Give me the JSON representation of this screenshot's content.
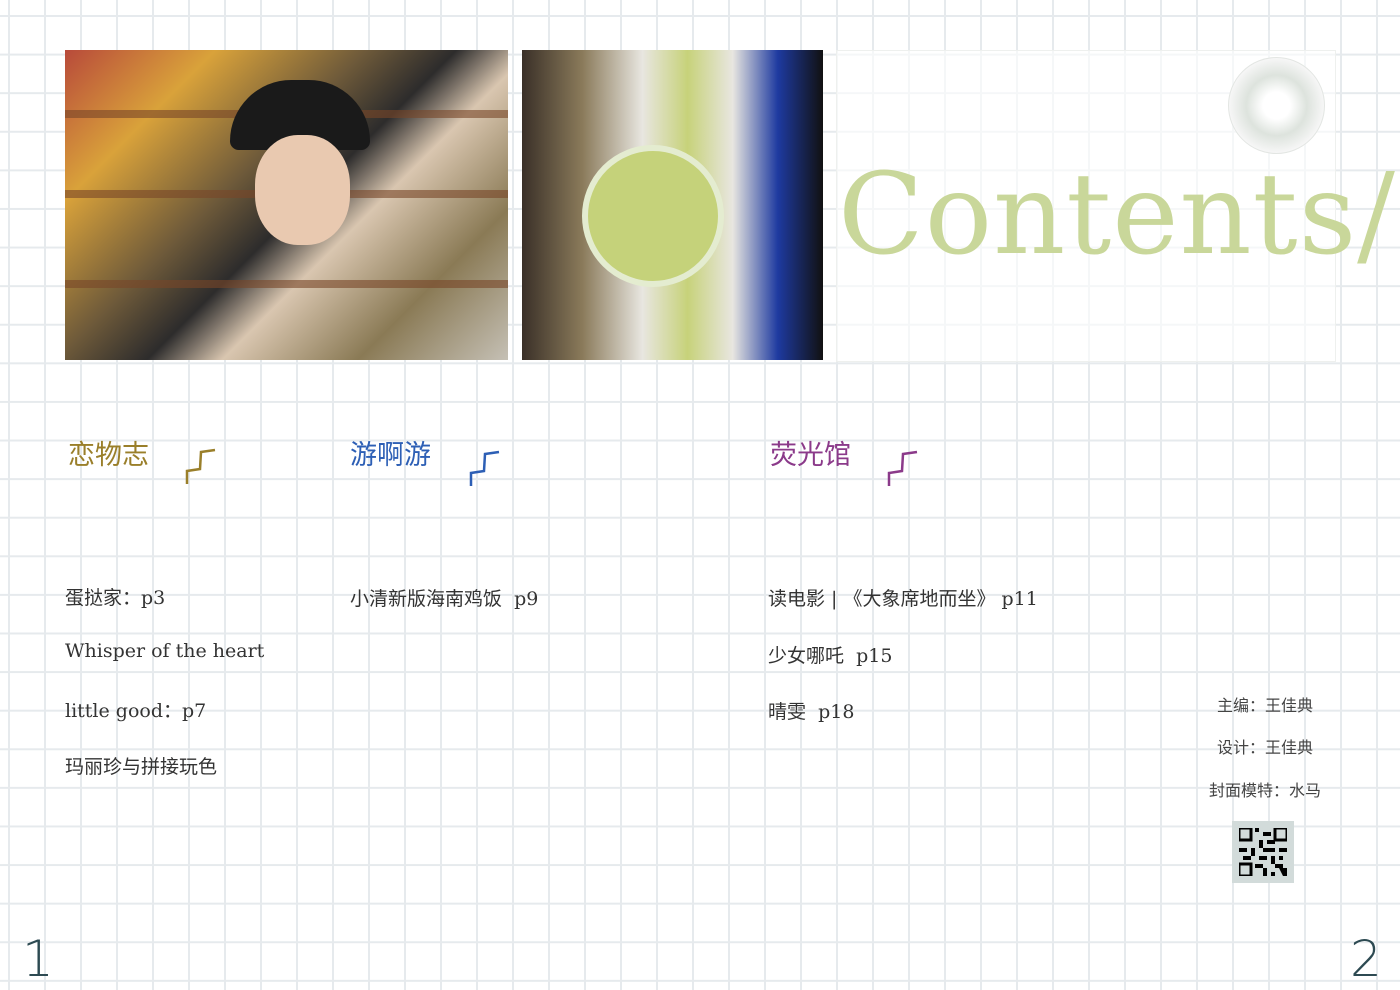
{
  "title": "Contents/",
  "colors": {
    "title": "#c9d79a",
    "section1": "#9a7f2a",
    "section2": "#2d5fb5",
    "section3": "#8b3a8a"
  },
  "sections": [
    {
      "heading": "恋物志",
      "items": [
        "蛋挞家：p3",
        "Whisper of the heart",
        "little good：p7",
        "玛丽珍与拼接玩色"
      ]
    },
    {
      "heading": "游啊游",
      "items": [
        "小清新版海南鸡饭  p9"
      ]
    },
    {
      "heading": "荧光馆",
      "items": [
        "读电影 | 《大象席地而坐》 p11",
        "少女哪吒  p15",
        "晴雯  p18"
      ]
    }
  ],
  "credits": [
    "主编：王佳典",
    "设计：王佳典",
    "封面模特：水马"
  ],
  "page_numbers": {
    "left": "1",
    "right": "2"
  }
}
